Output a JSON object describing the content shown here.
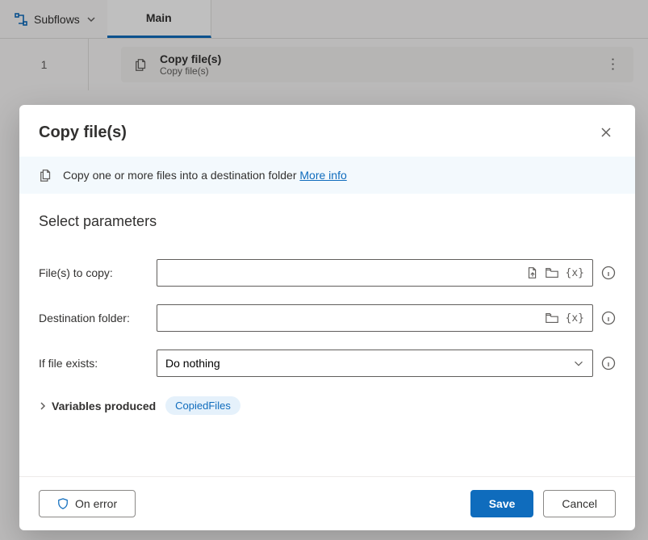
{
  "topbar": {
    "subflows_label": "Subflows",
    "tab_main": "Main"
  },
  "canvas": {
    "rownum": "1",
    "card_title": "Copy file(s)",
    "card_sub": "Copy file(s)"
  },
  "modal": {
    "title": "Copy file(s)",
    "info_text": "Copy one or more files into a destination folder ",
    "info_link": "More info",
    "section": "Select parameters",
    "labels": {
      "files": "File(s) to copy:",
      "dest": "Destination folder:",
      "exists": "If file exists:"
    },
    "values": {
      "files": "",
      "dest": "",
      "exists": "Do nothing"
    },
    "variables_label": "Variables produced",
    "variables_chip": "CopiedFiles",
    "buttons": {
      "onerror": "On error",
      "save": "Save",
      "cancel": "Cancel"
    },
    "var_token": "{x}"
  }
}
